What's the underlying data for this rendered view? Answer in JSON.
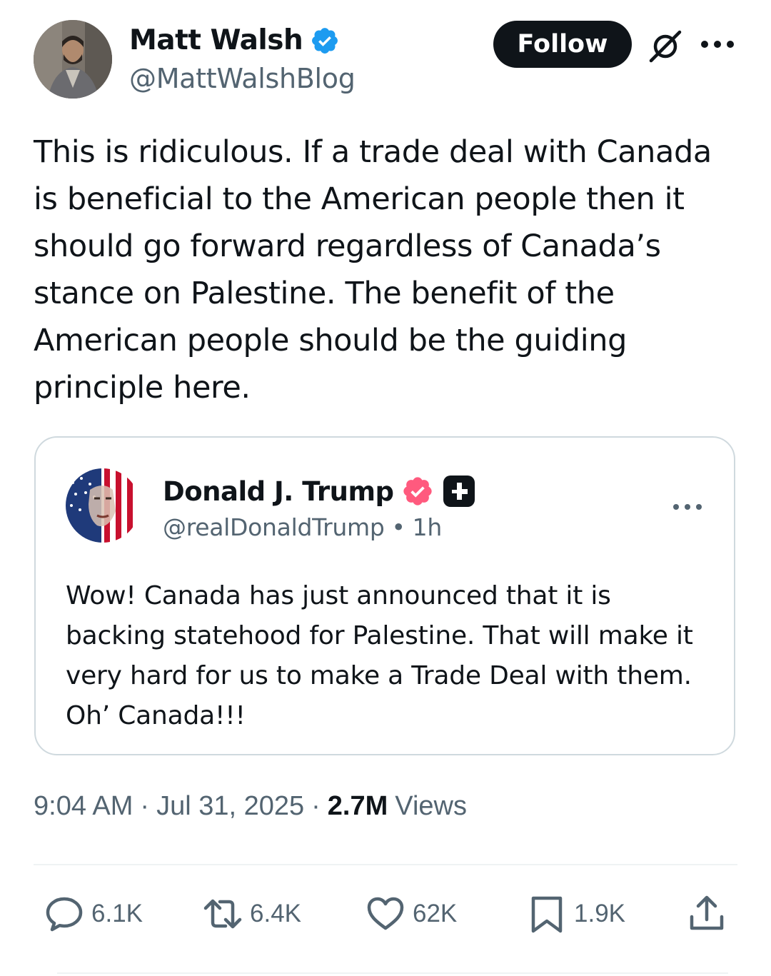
{
  "author": {
    "name": "Matt Walsh",
    "handle": "@MattWalshBlog",
    "follow_label": "Follow"
  },
  "tweet_text": "This is ridiculous. If a trade deal with Canada is beneficial to the American people then it should go forward regardless of Canada’s stance on Palestine. The benefit of the American people should be the guiding principle here.",
  "quoted": {
    "name": "Donald J. Trump",
    "handle": "@realDonaldTrump",
    "separator": "•",
    "age": "1h",
    "text": "Wow! Canada has just announced that it is backing statehood for Palestine. That will make it very hard for us to make a Trade Deal with them. Oh’ Canada!!!"
  },
  "meta": {
    "time": "9:04 AM",
    "separator": "·",
    "date": "Jul 31, 2025",
    "views_count": "2.7M",
    "views_label": "Views"
  },
  "actions": {
    "replies": "6.1K",
    "reposts": "6.4K",
    "likes": "62K",
    "bookmarks": "1.9K"
  },
  "colors": {
    "verified_blue": "#1d9bf0",
    "affiliate_pink": "#e0245e",
    "text_primary": "#0f1419",
    "text_secondary": "#536471",
    "border": "#cfd9de"
  },
  "icons": {
    "verified": "verified-badge-icon",
    "grok": "grok-icon",
    "more": "more-icon",
    "reply": "reply-icon",
    "repost": "repost-icon",
    "like": "heart-icon",
    "bookmark": "bookmark-icon",
    "share": "share-icon"
  }
}
